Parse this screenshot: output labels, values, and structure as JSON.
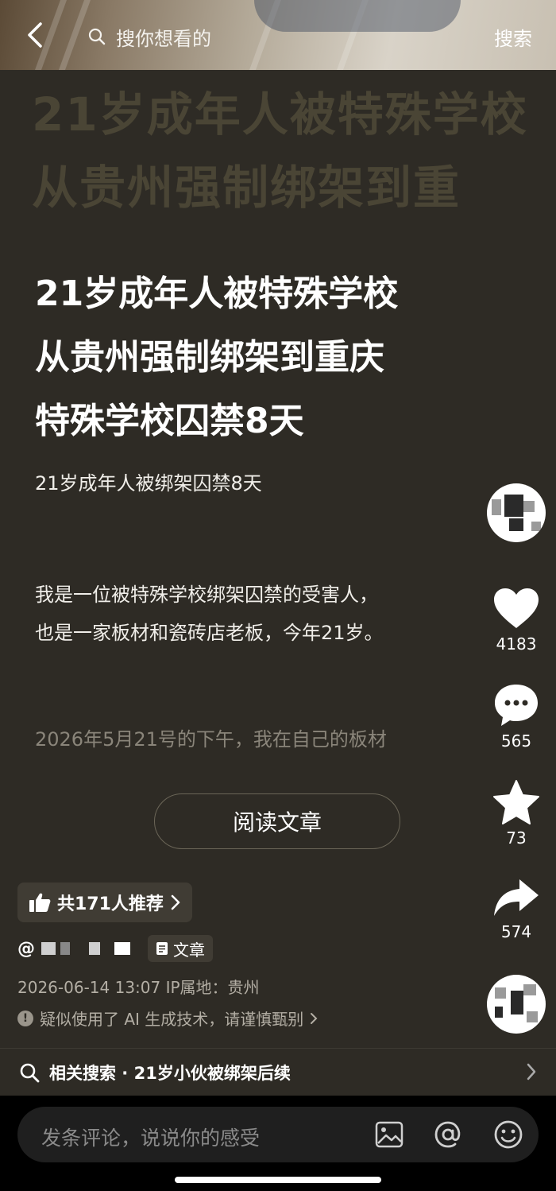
{
  "header": {
    "search_placeholder": "搜你想看的",
    "search_button": "搜索"
  },
  "post": {
    "background_title": "21岁成年人被特殊学校从贵州强制绑架到重",
    "title_lines": [
      "21岁成年人被特殊学校",
      "从贵州强制绑架到重庆",
      "特殊学校囚禁8天"
    ],
    "subtitle": "21岁成年人被绑架囚禁8天",
    "paragraph_lines": [
      "我是一位被特殊学校绑架囚禁的受害人，",
      "也是一家板材和瓷砖店老板，今年21岁。"
    ],
    "fade_line": "2026年5月21号的下午，我在自己的板材",
    "read_button": "阅读文章"
  },
  "actions": {
    "likes": "4183",
    "comments": "565",
    "favorites": "73",
    "shares": "574"
  },
  "meta": {
    "recommend": "共171人推荐",
    "author_prefix": "@",
    "article_tag": "文章",
    "datetime_location": "2026-06-14 13:07  IP属地：贵州",
    "ai_notice": "疑似使用了 AI 生成技术，请谨慎甄别"
  },
  "related": {
    "text": "相关搜索 · 21岁小伙被绑架后续"
  },
  "comment": {
    "placeholder": "发条评论，说说你的感受"
  }
}
